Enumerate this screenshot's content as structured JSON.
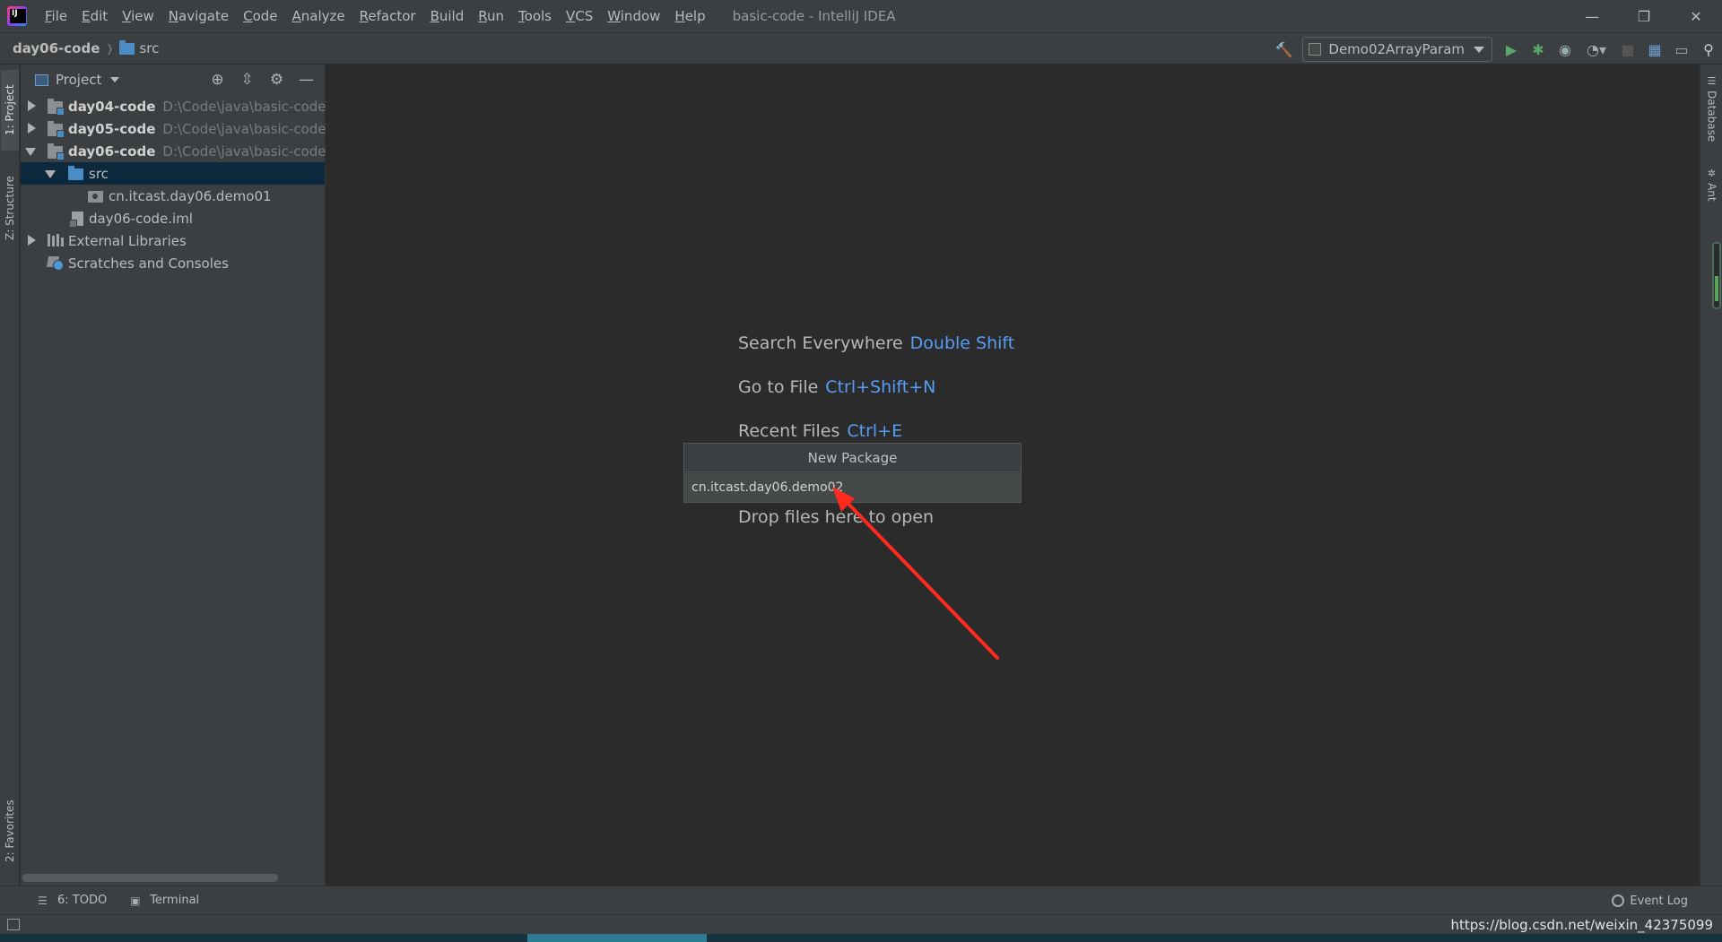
{
  "window": {
    "title": "basic-code - IntelliJ IDEA",
    "controls": {
      "minimize": "—",
      "restore": "❐",
      "close": "✕"
    }
  },
  "menu": [
    "File",
    "Edit",
    "View",
    "Navigate",
    "Code",
    "Analyze",
    "Refactor",
    "Build",
    "Run",
    "Tools",
    "VCS",
    "Window",
    "Help"
  ],
  "breadcrumb": {
    "project": "day06-code",
    "folder": "src"
  },
  "toolbar": {
    "run_config": "Demo02ArrayParam",
    "icons": [
      "build-hammer-icon",
      "run-icon",
      "debug-icon",
      "coverage-icon",
      "profile-icon",
      "stop-icon",
      "project-structure-icon",
      "presentation-icon",
      "search-everywhere-icon"
    ]
  },
  "left_strip": {
    "project_tab": "1: Project",
    "structure_tab": "Z: Structure",
    "favorites_tab": "2: Favorites"
  },
  "right_strip": {
    "database_tab": "Database",
    "ant_tab": "Ant"
  },
  "project_panel": {
    "title": "Project",
    "tree": [
      {
        "label": "day04-code",
        "path": "D:\\Code\\java\\basic-code\\day",
        "expanded": false
      },
      {
        "label": "day05-code",
        "path": "D:\\Code\\java\\basic-code\\day",
        "expanded": false
      },
      {
        "label": "day06-code",
        "path": "D:\\Code\\java\\basic-code\\day",
        "expanded": true
      },
      {
        "label": "src",
        "selected": true
      },
      {
        "label": "cn.itcast.day06.demo01"
      },
      {
        "label": "day06-code.iml"
      },
      {
        "label": "External Libraries",
        "expanded": false
      },
      {
        "label": "Scratches and Consoles"
      }
    ]
  },
  "editor_hints": [
    {
      "label": "Search Everywhere",
      "key": "Double Shift"
    },
    {
      "label": "Go to File",
      "key": "Ctrl+Shift+N"
    },
    {
      "label": "Recent Files",
      "key": "Ctrl+E"
    },
    {
      "label": "Drop files here to open",
      "key": ""
    }
  ],
  "dialog": {
    "title": "New Package",
    "value": "cn.itcast.day06.demo02"
  },
  "bottom_bar": {
    "todo": "6: TODO",
    "terminal": "Terminal",
    "event_log": "Event Log"
  },
  "status_bar": {
    "url": "https://blog.csdn.net/weixin_42375099"
  },
  "colors": {
    "accent_key": "#589df6",
    "selection": "#0d293e",
    "annotation_arrow": "#ff2a1f"
  }
}
